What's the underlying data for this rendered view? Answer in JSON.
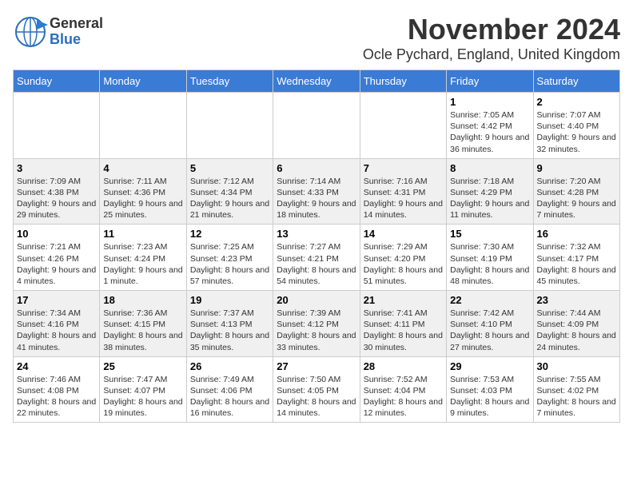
{
  "header": {
    "logo_general": "General",
    "logo_blue": "Blue",
    "title": "November 2024",
    "subtitle": "Ocle Pychard, England, United Kingdom"
  },
  "calendar": {
    "days_of_week": [
      "Sunday",
      "Monday",
      "Tuesday",
      "Wednesday",
      "Thursday",
      "Friday",
      "Saturday"
    ],
    "weeks": [
      [
        {
          "day": "",
          "info": ""
        },
        {
          "day": "",
          "info": ""
        },
        {
          "day": "",
          "info": ""
        },
        {
          "day": "",
          "info": ""
        },
        {
          "day": "",
          "info": ""
        },
        {
          "day": "1",
          "info": "Sunrise: 7:05 AM\nSunset: 4:42 PM\nDaylight: 9 hours and 36 minutes."
        },
        {
          "day": "2",
          "info": "Sunrise: 7:07 AM\nSunset: 4:40 PM\nDaylight: 9 hours and 32 minutes."
        }
      ],
      [
        {
          "day": "3",
          "info": "Sunrise: 7:09 AM\nSunset: 4:38 PM\nDaylight: 9 hours and 29 minutes."
        },
        {
          "day": "4",
          "info": "Sunrise: 7:11 AM\nSunset: 4:36 PM\nDaylight: 9 hours and 25 minutes."
        },
        {
          "day": "5",
          "info": "Sunrise: 7:12 AM\nSunset: 4:34 PM\nDaylight: 9 hours and 21 minutes."
        },
        {
          "day": "6",
          "info": "Sunrise: 7:14 AM\nSunset: 4:33 PM\nDaylight: 9 hours and 18 minutes."
        },
        {
          "day": "7",
          "info": "Sunrise: 7:16 AM\nSunset: 4:31 PM\nDaylight: 9 hours and 14 minutes."
        },
        {
          "day": "8",
          "info": "Sunrise: 7:18 AM\nSunset: 4:29 PM\nDaylight: 9 hours and 11 minutes."
        },
        {
          "day": "9",
          "info": "Sunrise: 7:20 AM\nSunset: 4:28 PM\nDaylight: 9 hours and 7 minutes."
        }
      ],
      [
        {
          "day": "10",
          "info": "Sunrise: 7:21 AM\nSunset: 4:26 PM\nDaylight: 9 hours and 4 minutes."
        },
        {
          "day": "11",
          "info": "Sunrise: 7:23 AM\nSunset: 4:24 PM\nDaylight: 9 hours and 1 minute."
        },
        {
          "day": "12",
          "info": "Sunrise: 7:25 AM\nSunset: 4:23 PM\nDaylight: 8 hours and 57 minutes."
        },
        {
          "day": "13",
          "info": "Sunrise: 7:27 AM\nSunset: 4:21 PM\nDaylight: 8 hours and 54 minutes."
        },
        {
          "day": "14",
          "info": "Sunrise: 7:29 AM\nSunset: 4:20 PM\nDaylight: 8 hours and 51 minutes."
        },
        {
          "day": "15",
          "info": "Sunrise: 7:30 AM\nSunset: 4:19 PM\nDaylight: 8 hours and 48 minutes."
        },
        {
          "day": "16",
          "info": "Sunrise: 7:32 AM\nSunset: 4:17 PM\nDaylight: 8 hours and 45 minutes."
        }
      ],
      [
        {
          "day": "17",
          "info": "Sunrise: 7:34 AM\nSunset: 4:16 PM\nDaylight: 8 hours and 41 minutes."
        },
        {
          "day": "18",
          "info": "Sunrise: 7:36 AM\nSunset: 4:15 PM\nDaylight: 8 hours and 38 minutes."
        },
        {
          "day": "19",
          "info": "Sunrise: 7:37 AM\nSunset: 4:13 PM\nDaylight: 8 hours and 35 minutes."
        },
        {
          "day": "20",
          "info": "Sunrise: 7:39 AM\nSunset: 4:12 PM\nDaylight: 8 hours and 33 minutes."
        },
        {
          "day": "21",
          "info": "Sunrise: 7:41 AM\nSunset: 4:11 PM\nDaylight: 8 hours and 30 minutes."
        },
        {
          "day": "22",
          "info": "Sunrise: 7:42 AM\nSunset: 4:10 PM\nDaylight: 8 hours and 27 minutes."
        },
        {
          "day": "23",
          "info": "Sunrise: 7:44 AM\nSunset: 4:09 PM\nDaylight: 8 hours and 24 minutes."
        }
      ],
      [
        {
          "day": "24",
          "info": "Sunrise: 7:46 AM\nSunset: 4:08 PM\nDaylight: 8 hours and 22 minutes."
        },
        {
          "day": "25",
          "info": "Sunrise: 7:47 AM\nSunset: 4:07 PM\nDaylight: 8 hours and 19 minutes."
        },
        {
          "day": "26",
          "info": "Sunrise: 7:49 AM\nSunset: 4:06 PM\nDaylight: 8 hours and 16 minutes."
        },
        {
          "day": "27",
          "info": "Sunrise: 7:50 AM\nSunset: 4:05 PM\nDaylight: 8 hours and 14 minutes."
        },
        {
          "day": "28",
          "info": "Sunrise: 7:52 AM\nSunset: 4:04 PM\nDaylight: 8 hours and 12 minutes."
        },
        {
          "day": "29",
          "info": "Sunrise: 7:53 AM\nSunset: 4:03 PM\nDaylight: 8 hours and 9 minutes."
        },
        {
          "day": "30",
          "info": "Sunrise: 7:55 AM\nSunset: 4:02 PM\nDaylight: 8 hours and 7 minutes."
        }
      ]
    ]
  }
}
